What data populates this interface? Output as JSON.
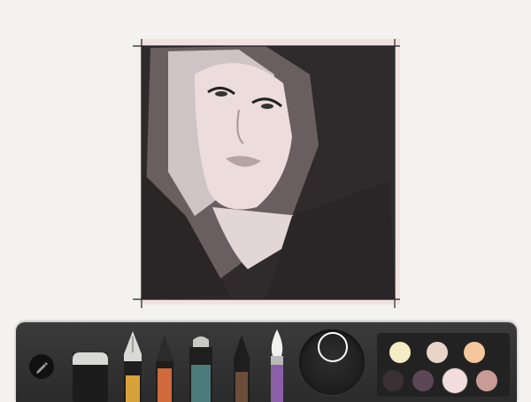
{
  "toolbar": {
    "tools": [
      {
        "name": "edit",
        "icon": "pencil-icon"
      },
      {
        "name": "eraser",
        "icon": "eraser-icon"
      },
      {
        "name": "fountain-pen",
        "icon": "fountain-pen-icon",
        "color": "#d8a23a"
      },
      {
        "name": "pencil",
        "icon": "pencil-tool-icon",
        "color": "#d0693b"
      },
      {
        "name": "marker",
        "icon": "marker-icon",
        "color": "#4d7a7b"
      },
      {
        "name": "outline-pen",
        "icon": "pen-icon",
        "color": "#6b4e3a"
      },
      {
        "name": "brush",
        "icon": "brush-icon",
        "color": "#8b5fa8"
      }
    ],
    "color_dial": {
      "icon": "color-mixer-icon"
    }
  },
  "palette": {
    "swatches": [
      "#f4ecc4",
      "#e8d5c7",
      "#f4c79d",
      "#3a3034",
      "#5b4656",
      "#f2dcdc",
      "#c99b96"
    ],
    "selected_index": 5
  }
}
